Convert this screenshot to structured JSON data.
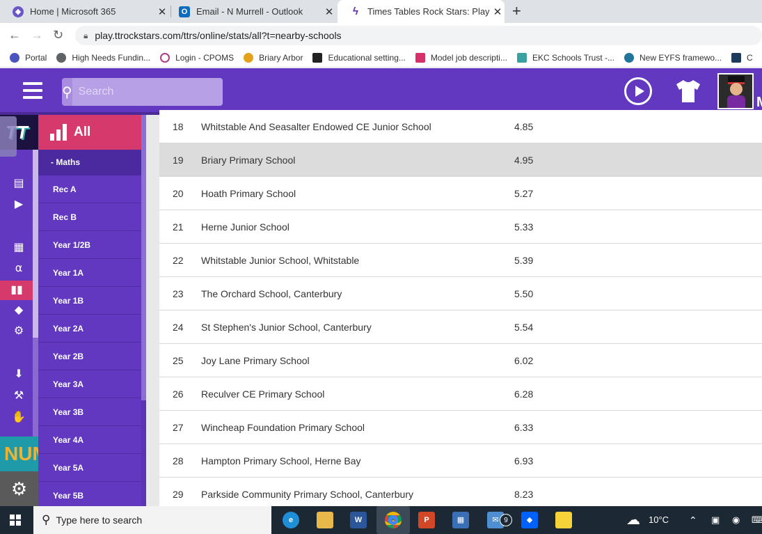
{
  "browser": {
    "tabs": [
      {
        "title": "Home | Microsoft 365",
        "icon": "microsoft365-icon",
        "active": false
      },
      {
        "title": "Email - N Murrell - Outlook",
        "icon": "outlook-icon",
        "active": false
      },
      {
        "title": "Times Tables Rock Stars: Play",
        "icon": "ttrs-icon",
        "active": true
      }
    ],
    "url": "play.ttrockstars.com/ttrs/online/stats/all?t=nearby-schools",
    "bookmarks": [
      {
        "label": "Portal",
        "color": "#4b53bc"
      },
      {
        "label": "High Needs Fundin...",
        "color": "#5f6368"
      },
      {
        "label": "Login - CPOMS",
        "color": "#b03a8a"
      },
      {
        "label": "Briary Arbor",
        "color": "#e3a21a"
      },
      {
        "label": "Educational setting...",
        "color": "#222222"
      },
      {
        "label": "Model job descripti...",
        "color": "#d6306b"
      },
      {
        "label": "EKC Schools Trust -...",
        "color": "#3aa0a0"
      },
      {
        "label": "New EYFS framewo...",
        "color": "#21759b"
      },
      {
        "label": "C",
        "color": "#1b3a5c"
      }
    ]
  },
  "header": {
    "search_placeholder": "Search",
    "trailing_letter": "M"
  },
  "sidebar": {
    "title": "All",
    "subtitle": "- Maths",
    "items": [
      "Rec A",
      "Rec B",
      "Year 1/2B",
      "Year 1A",
      "Year 1B",
      "Year 2A",
      "Year 2B",
      "Year 3A",
      "Year 3B",
      "Year 4A",
      "Year 5A",
      "Year 5B"
    ]
  },
  "rail": {
    "logo_text": "TT",
    "num_text": "NUM",
    "icons": [
      "document-icon",
      "video-icon",
      "grid-icon",
      "headphones-icon",
      "stats-icon",
      "ticket-icon",
      "gear-icon",
      "download-icon",
      "wrench-icon",
      "hand-icon",
      "settings-icon"
    ]
  },
  "table": {
    "rows": [
      {
        "rank": "18",
        "school": "Whitstable And Seasalter Endowed CE Junior School",
        "time": "4.85",
        "highlight": false
      },
      {
        "rank": "19",
        "school": "Briary Primary School",
        "time": "4.95",
        "highlight": true
      },
      {
        "rank": "20",
        "school": "Hoath Primary School",
        "time": "5.27",
        "highlight": false
      },
      {
        "rank": "21",
        "school": "Herne Junior School",
        "time": "5.33",
        "highlight": false
      },
      {
        "rank": "22",
        "school": "Whitstable Junior School, Whitstable",
        "time": "5.39",
        "highlight": false
      },
      {
        "rank": "23",
        "school": "The Orchard School, Canterbury",
        "time": "5.50",
        "highlight": false
      },
      {
        "rank": "24",
        "school": "St Stephen's Junior School, Canterbury",
        "time": "5.54",
        "highlight": false
      },
      {
        "rank": "25",
        "school": "Joy Lane Primary School",
        "time": "6.02",
        "highlight": false
      },
      {
        "rank": "26",
        "school": "Reculver CE Primary School",
        "time": "6.28",
        "highlight": false
      },
      {
        "rank": "27",
        "school": "Wincheap Foundation Primary School",
        "time": "6.33",
        "highlight": false
      },
      {
        "rank": "28",
        "school": "Hampton Primary School, Herne Bay",
        "time": "6.93",
        "highlight": false
      },
      {
        "rank": "29",
        "school": "Parkside Community Primary School, Canterbury",
        "time": "8.23",
        "highlight": false
      }
    ]
  },
  "taskbar": {
    "search_placeholder": "Type here to search",
    "mail_badge": "9",
    "temperature": "10°C",
    "apps": [
      "edge-icon",
      "file-explorer-icon",
      "word-icon",
      "chrome-icon",
      "powerpoint-icon",
      "store-icon",
      "mail-icon",
      "dropbox-icon",
      "sticky-notes-icon"
    ]
  },
  "colors": {
    "brand_purple": "#6238c0",
    "accent_pink": "#d63a6d",
    "row_highlight": "#dcdcdc"
  }
}
